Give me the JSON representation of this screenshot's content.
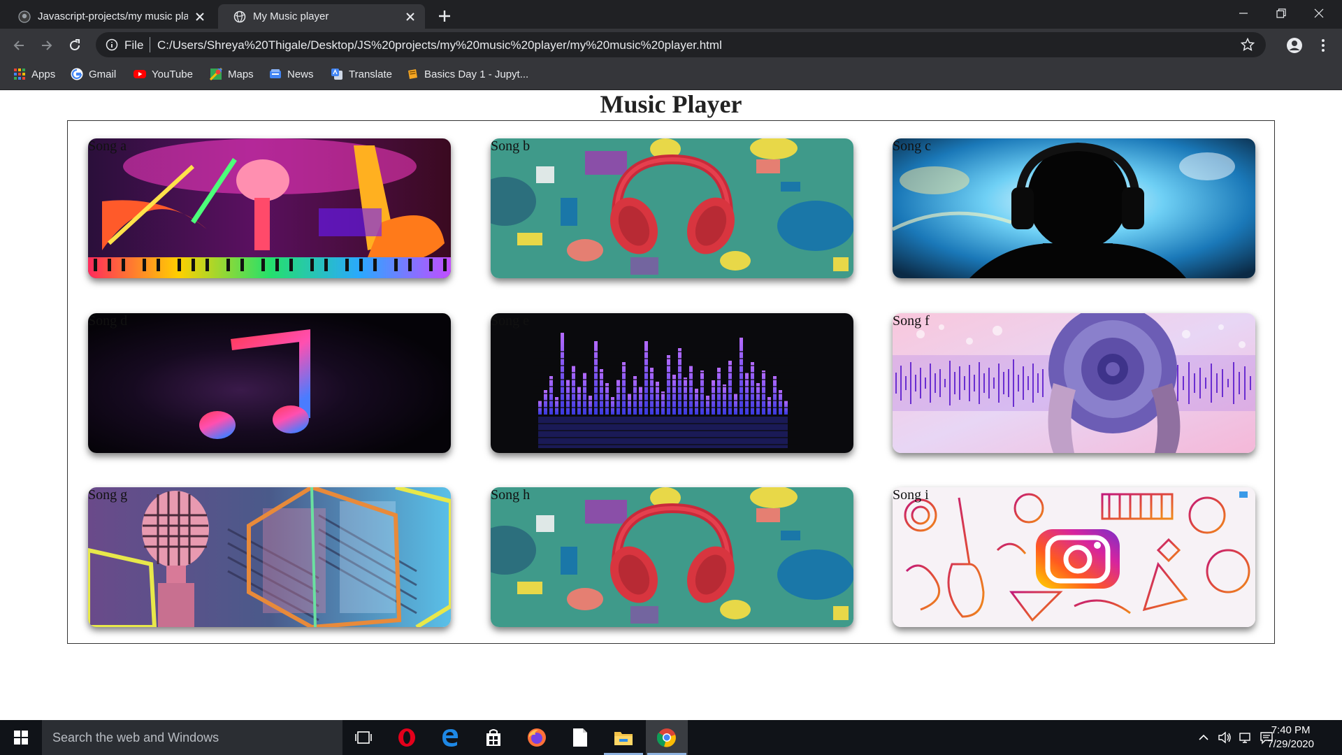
{
  "browser": {
    "tabs": [
      {
        "title": "Javascript-projects/my music pla",
        "icon": "github-icon",
        "active": false
      },
      {
        "title": "My Music player",
        "icon": "globe-icon",
        "active": true
      }
    ],
    "address": {
      "scheme_label": "File",
      "url": "C:/Users/Shreya%20Thigale/Desktop/JS%20projects/my%20music%20player/my%20music%20player.html"
    },
    "bookmarks": [
      {
        "label": "Apps",
        "icon": "apps-grid-icon"
      },
      {
        "label": "Gmail",
        "icon": "google-icon"
      },
      {
        "label": "YouTube",
        "icon": "youtube-icon"
      },
      {
        "label": "Maps",
        "icon": "maps-icon"
      },
      {
        "label": "News",
        "icon": "news-icon"
      },
      {
        "label": "Translate",
        "icon": "translate-icon"
      },
      {
        "label": "Basics Day 1 - Jupyt...",
        "icon": "jupyter-icon"
      }
    ]
  },
  "page": {
    "title": "Music Player",
    "songs": [
      {
        "label": "Song a",
        "art": "neon-instruments"
      },
      {
        "label": "Song b",
        "art": "red-headphones"
      },
      {
        "label": "Song c",
        "art": "headphone-silhouette"
      },
      {
        "label": "Song d",
        "art": "apple-music-note"
      },
      {
        "label": "Song e",
        "art": "equalizer-bars"
      },
      {
        "label": "Song f",
        "art": "sound-wave-speaker"
      },
      {
        "label": "Song g",
        "art": "vintage-microphone"
      },
      {
        "label": "Song h",
        "art": "red-headphones"
      },
      {
        "label": "Song i",
        "art": "instagram-doodles"
      }
    ]
  },
  "taskbar": {
    "search_placeholder": "Search the web and Windows",
    "apps": [
      "task-view-icon",
      "opera-icon",
      "edge-icon",
      "store-icon",
      "firefox-icon",
      "file-icon",
      "file-explorer-icon",
      "chrome-icon"
    ],
    "clock": {
      "time": "7:40 PM",
      "date": "7/29/2020"
    }
  }
}
